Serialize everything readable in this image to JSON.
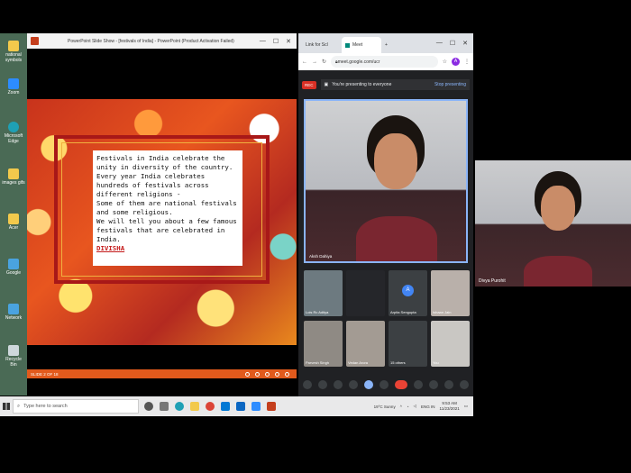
{
  "desktop_icons": [
    {
      "label": "national symbols",
      "color": "#f2c94c"
    },
    {
      "label": "Zoom",
      "color": "#2d8cff"
    },
    {
      "label": "Microsoft Edge",
      "color": "#1fa0b5"
    },
    {
      "label": "images gifs",
      "color": "#f2c94c"
    },
    {
      "label": "Acer",
      "color": "#f2c94c"
    },
    {
      "label": "Google",
      "color": "#4aa3df"
    },
    {
      "label": "Network",
      "color": "#4aa3df"
    },
    {
      "label": "Recycle Bin",
      "color": "#cfd8dc"
    }
  ],
  "ppt": {
    "title": "PowerPoint Slide Show - [festivals of India] - PowerPoint (Product Activation Failed)",
    "minimize": "—",
    "maximize": "☐",
    "close": "✕",
    "slide_text": "Festivals in India celebrate the unity in diversity of the country. Every year India celebrates hundreds of festivals across different religions -\nSome of them are national festivals and some religious.\nWe will tell you about a few famous festivals that are celebrated in India.",
    "author": "DIVISHA",
    "status": "SLIDE 2 OF 18"
  },
  "chrome": {
    "tab1": "Link for Scl",
    "tab2": "Meet",
    "new_tab": "+",
    "url": "meet.google.com/ucr",
    "avatar_letter": "A"
  },
  "meet": {
    "rec": "REC",
    "presenting_text": "You're presenting to everyone",
    "stop_presenting": "Stop presenting",
    "main_name": "Aksh Dahiya",
    "tiles": [
      {
        "name": "Lois Rc Aditya",
        "type": "video",
        "color": "#6d7a80"
      },
      {
        "name": "",
        "type": "screen",
        "color": "#25262a"
      },
      {
        "name": "Arpita Sengupta",
        "type": "initial",
        "initial": "A",
        "color": "#4285f4"
      },
      {
        "name": "Ishaan Jain",
        "type": "video",
        "color": "#b9b0aa"
      },
      {
        "name": "Parvesh Singh",
        "type": "video",
        "color": "#8f8a84"
      },
      {
        "name": "Vedan Arora",
        "type": "video",
        "color": "#a39b93"
      },
      {
        "name": "15 others",
        "type": "others",
        "color": "#3c4043"
      },
      {
        "name": "You",
        "type": "video",
        "color": "#c9c7c3"
      }
    ]
  },
  "selfview": {
    "name": "Divya Purohit"
  },
  "taskbar": {
    "search_placeholder": "Type here to search",
    "weather": "19°C  Sunny",
    "lang": "ENG IN",
    "time": "9:53 AM",
    "date": "11/23/2021"
  }
}
